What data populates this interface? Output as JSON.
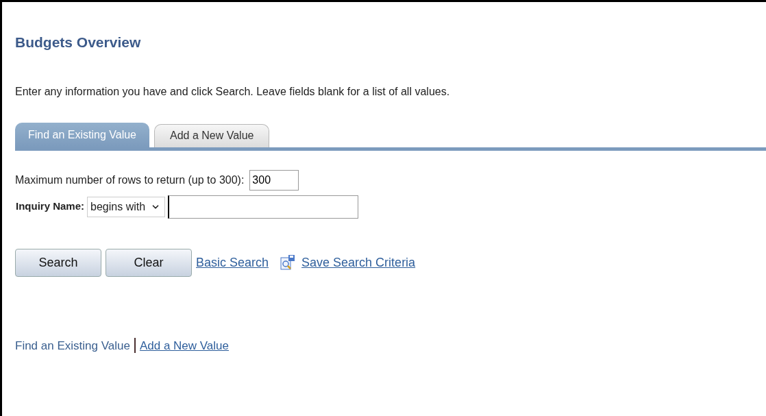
{
  "title": "Budgets Overview",
  "instructions": "Enter any information you have and click Search. Leave fields blank for a list of all values.",
  "tabs": [
    {
      "label": "Find an Existing Value",
      "selected": true
    },
    {
      "label": "Add a New Value",
      "selected": false
    }
  ],
  "max_rows": {
    "label": "Maximum number of rows to return (up to 300):",
    "value": "300"
  },
  "inquiry_name": {
    "label": "Inquiry Name:",
    "operator": "begins with"
  },
  "buttons": [
    "Search",
    "Clear"
  ],
  "links": [
    "Basic Search",
    "Save Search Criteria"
  ],
  "footer_links": [
    {
      "label": "Find an Existing Value",
      "selected": true
    },
    {
      "label": "Add a New Value",
      "selected": false
    }
  ]
}
